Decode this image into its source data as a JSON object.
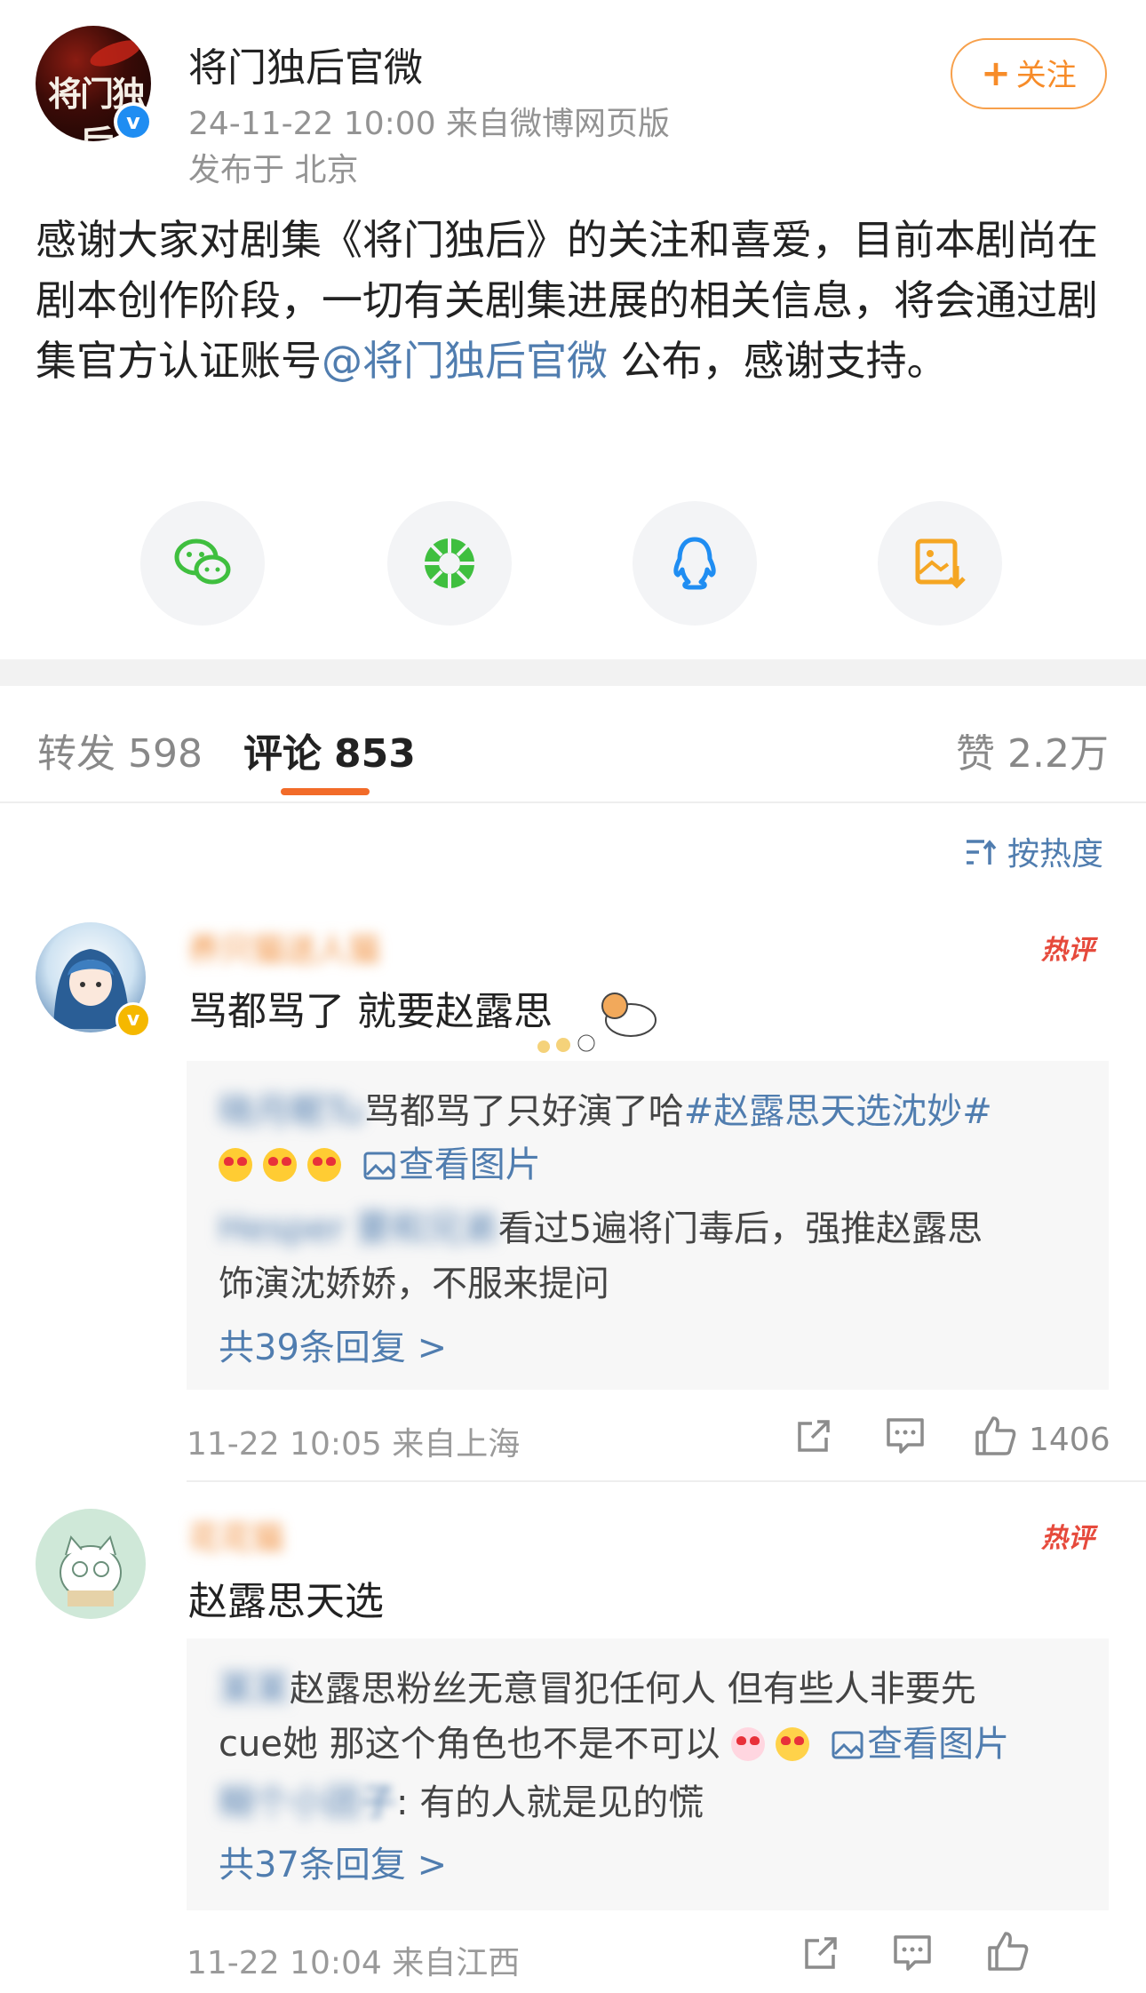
{
  "post": {
    "author": "将门独后官微",
    "avatar_text": "将门独后",
    "verified_mark": "v",
    "meta": "24-11-22 10:00  来自微博网页版",
    "location": "发布于 北京",
    "follow_label": "关注",
    "follow_plus": "+",
    "body_before": "感谢大家对剧集《将门独后》的关注和喜爱，目前本剧尚在剧本创作阶段，一切有关剧集进展的相关信息，将会通过剧集官方认证账号",
    "body_mention": "@将门独后官微",
    "body_after": " 公布，感谢支持。"
  },
  "share": {
    "icons": [
      "wechat-icon",
      "moments-icon",
      "qq-icon",
      "save-image-icon"
    ]
  },
  "tabs": {
    "repost_label": "转发",
    "repost_count": "598",
    "comment_label": "评论",
    "comment_count": "853",
    "like_label": "赞",
    "like_count": "2.2万"
  },
  "sort": {
    "label": "按热度"
  },
  "comments": [
    {
      "hot_tag": "热评",
      "name_blurred": "养只猫送人猫",
      "text": "骂都骂了 就要赵露思",
      "replies": [
        {
          "name_blurred": "晓月眠Tu",
          "text": "骂都骂了只好演了哈",
          "hashtag": "#赵露思天选沈妙#",
          "view_image": "查看图片"
        },
        {
          "name_blurred": "Hesper 要和兄弟",
          "text": "看过5遍将门毒后，强推赵露思",
          "text2": "饰演沈娇娇，不服来提问"
        }
      ],
      "reply_count": "共39条回复 >",
      "meta": "11-22 10:05  来自上海",
      "likes": "1406"
    },
    {
      "hot_tag": "热评",
      "name_blurred": "花花猫",
      "text": "赵露思天选",
      "replies": [
        {
          "name_blurred": "某某",
          "text": "赵露思粉丝无意冒犯任何人 但有些人非要先",
          "text2": "cue她 那这个角色也不是不可以",
          "view_image": "查看图片"
        },
        {
          "name_blurred": "糊个小团",
          "suffix": "子",
          "text": ": 有的人就是见的慌"
        }
      ],
      "reply_count": "共37条回复 >",
      "meta": "11-22 10:04  来自江西"
    }
  ],
  "colors": {
    "accent": "#f78c29",
    "link": "#507daf",
    "hot": "#e64a3c",
    "verified": "#1f8df2"
  }
}
